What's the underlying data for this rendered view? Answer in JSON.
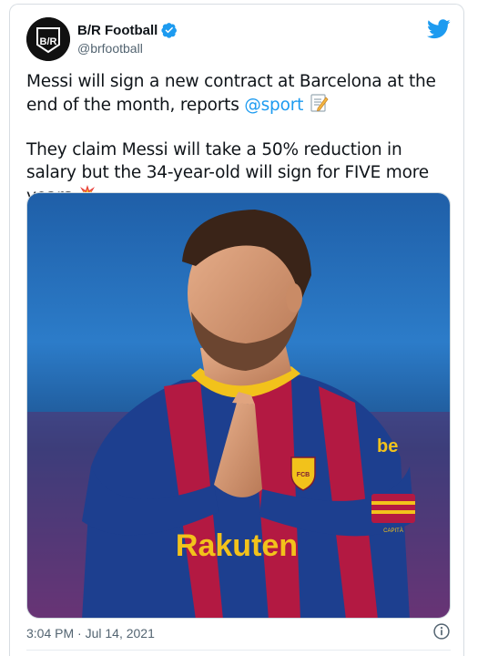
{
  "tweet": {
    "display_name": "B/R Football",
    "handle": "@brfootball",
    "text_line1_before": "Messi will sign a new contract at Barcelona at the end of the month, reports ",
    "mention": "@sport",
    "text_line2": "They claim Messi will take a 50% reduction in salary but the 34-year-old will sign for FIVE more years",
    "timestamp": "3:04 PM · Jul 14, 2021"
  },
  "avatar": {
    "logo_text": "B/R"
  },
  "media": {
    "shirt_sponsor": "Rakuten",
    "shirt_badge": "FCB",
    "sleeve_brand": "be",
    "armband": "CAPITÀ"
  },
  "icons": {
    "verified": "verified-badge-icon",
    "brand": "twitter-bird-icon",
    "memo": "memo-emoji-icon",
    "collision": "collision-emoji-icon",
    "info": "info-icon"
  },
  "colors": {
    "accent": "#1d9bf0",
    "text": "#0f1419",
    "muted": "#536471",
    "border": "#cfd9de"
  }
}
